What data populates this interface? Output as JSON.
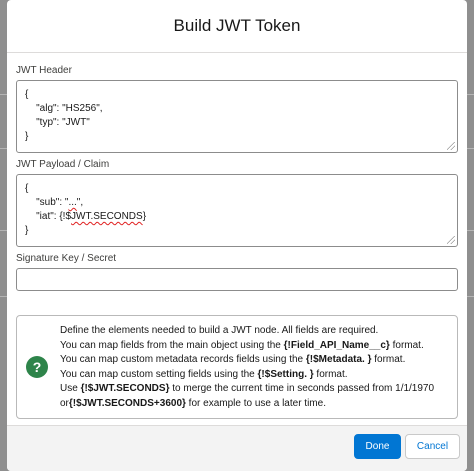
{
  "modal": {
    "title": "Build JWT Token"
  },
  "header_field": {
    "label": "JWT Header",
    "lines": [
      "{",
      "    \"alg\": \"HS256\",",
      "    \"typ\": \"JWT\"",
      "}"
    ]
  },
  "payload_field": {
    "label": "JWT Payload / Claim",
    "line0": "{",
    "line1_pre": "    \"sub\": \"",
    "line1_spell": "...",
    "line1_post": "\",",
    "line2_pre": "    \"iat\": {!$",
    "line2_spell": "JWT.SECONDS",
    "line2_post": "}",
    "line3": "}"
  },
  "signature_field": {
    "label": "Signature Key / Secret",
    "value": ""
  },
  "help": {
    "icon_glyph": "?",
    "line1": "Define the elements needed to build a JWT node. All fields are required.",
    "line2_pre": "You can map fields from the main object using the ",
    "line2_bold": "{!Field_API_Name__c}",
    "line2_post": " format.",
    "line3_pre": "You can map custom metadata records fields using the ",
    "line3_bold": "{!$Metadata. }",
    "line3_post": " format.",
    "line4_pre": "You can map custom setting fields using the ",
    "line4_bold": "{!$Setting. }",
    "line4_post": " format.",
    "line5_pre": "Use ",
    "line5_bold": "{!$JWT.SECONDS}",
    "line5_post": " to merge the current time in seconds passed from 1/1/1970",
    "line6_pre": "or",
    "line6_bold": "{!$JWT.SECONDS+3600}",
    "line6_post": " for example to use a later time."
  },
  "footer": {
    "done_label": "Done",
    "cancel_label": "Cancel"
  },
  "colors": {
    "brand": "#0176d3",
    "success": "#2e844a",
    "overlay": "#8f8f8f"
  }
}
